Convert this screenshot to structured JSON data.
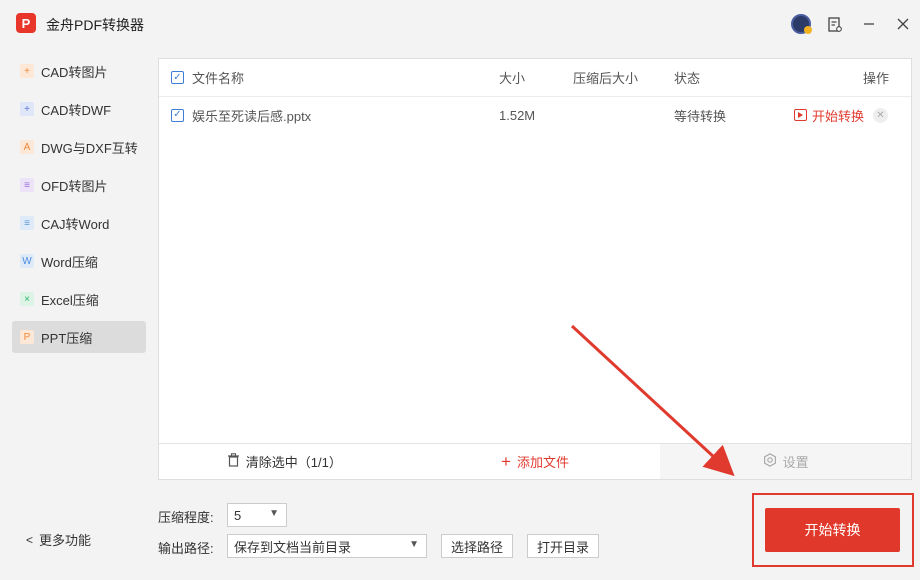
{
  "app": {
    "title": "金舟PDF转换器",
    "logo_text": "P"
  },
  "titlebar_icons": [
    "avatar-icon",
    "notes-icon",
    "minimize-icon",
    "close-icon"
  ],
  "sidebar": {
    "items": [
      {
        "label": "CAD转图片",
        "icon": "cad-image-icon",
        "color": "#f0893a",
        "active": false
      },
      {
        "label": "CAD转DWF",
        "icon": "cad-dwf-icon",
        "color": "#5b78d6",
        "active": false
      },
      {
        "label": "DWG与DXF互转",
        "icon": "dwg-dxf-icon",
        "color": "#f0893a",
        "active": false
      },
      {
        "label": "OFD转图片",
        "icon": "ofd-image-icon",
        "color": "#9b6ed6",
        "active": false
      },
      {
        "label": "CAJ转Word",
        "icon": "caj-word-icon",
        "color": "#5b9bd6",
        "active": false
      },
      {
        "label": "Word压缩",
        "icon": "word-compress-icon",
        "color": "#4a8ee0",
        "active": false
      },
      {
        "label": "Excel压缩",
        "icon": "excel-compress-icon",
        "color": "#2fb56b",
        "active": false
      },
      {
        "label": "PPT压缩",
        "icon": "ppt-compress-icon",
        "color": "#f0893a",
        "active": true
      }
    ],
    "more_label": "更多功能"
  },
  "table": {
    "headers": {
      "name": "文件名称",
      "size": "大小",
      "compressed_size": "压缩后大小",
      "status": "状态",
      "action": "操作"
    },
    "rows": [
      {
        "name": "娱乐至死读后感.pptx",
        "size": "1.52M",
        "compressed_size": "",
        "status": "等待转换",
        "action": "开始转换",
        "checked": true
      }
    ]
  },
  "footer": {
    "clear_label": "清除选中（1/1）",
    "add_label": "添加文件",
    "settings_label": "设置"
  },
  "controls": {
    "compress_level_label": "压缩程度:",
    "compress_level_value": "5",
    "output_path_label": "输出路径:",
    "output_path_value": "保存到文档当前目录",
    "choose_path_label": "选择路径",
    "open_dir_label": "打开目录",
    "start_label": "开始转换"
  },
  "colors": {
    "accent_red": "#e0392b",
    "checkbox_blue": "#3d7fd6"
  }
}
